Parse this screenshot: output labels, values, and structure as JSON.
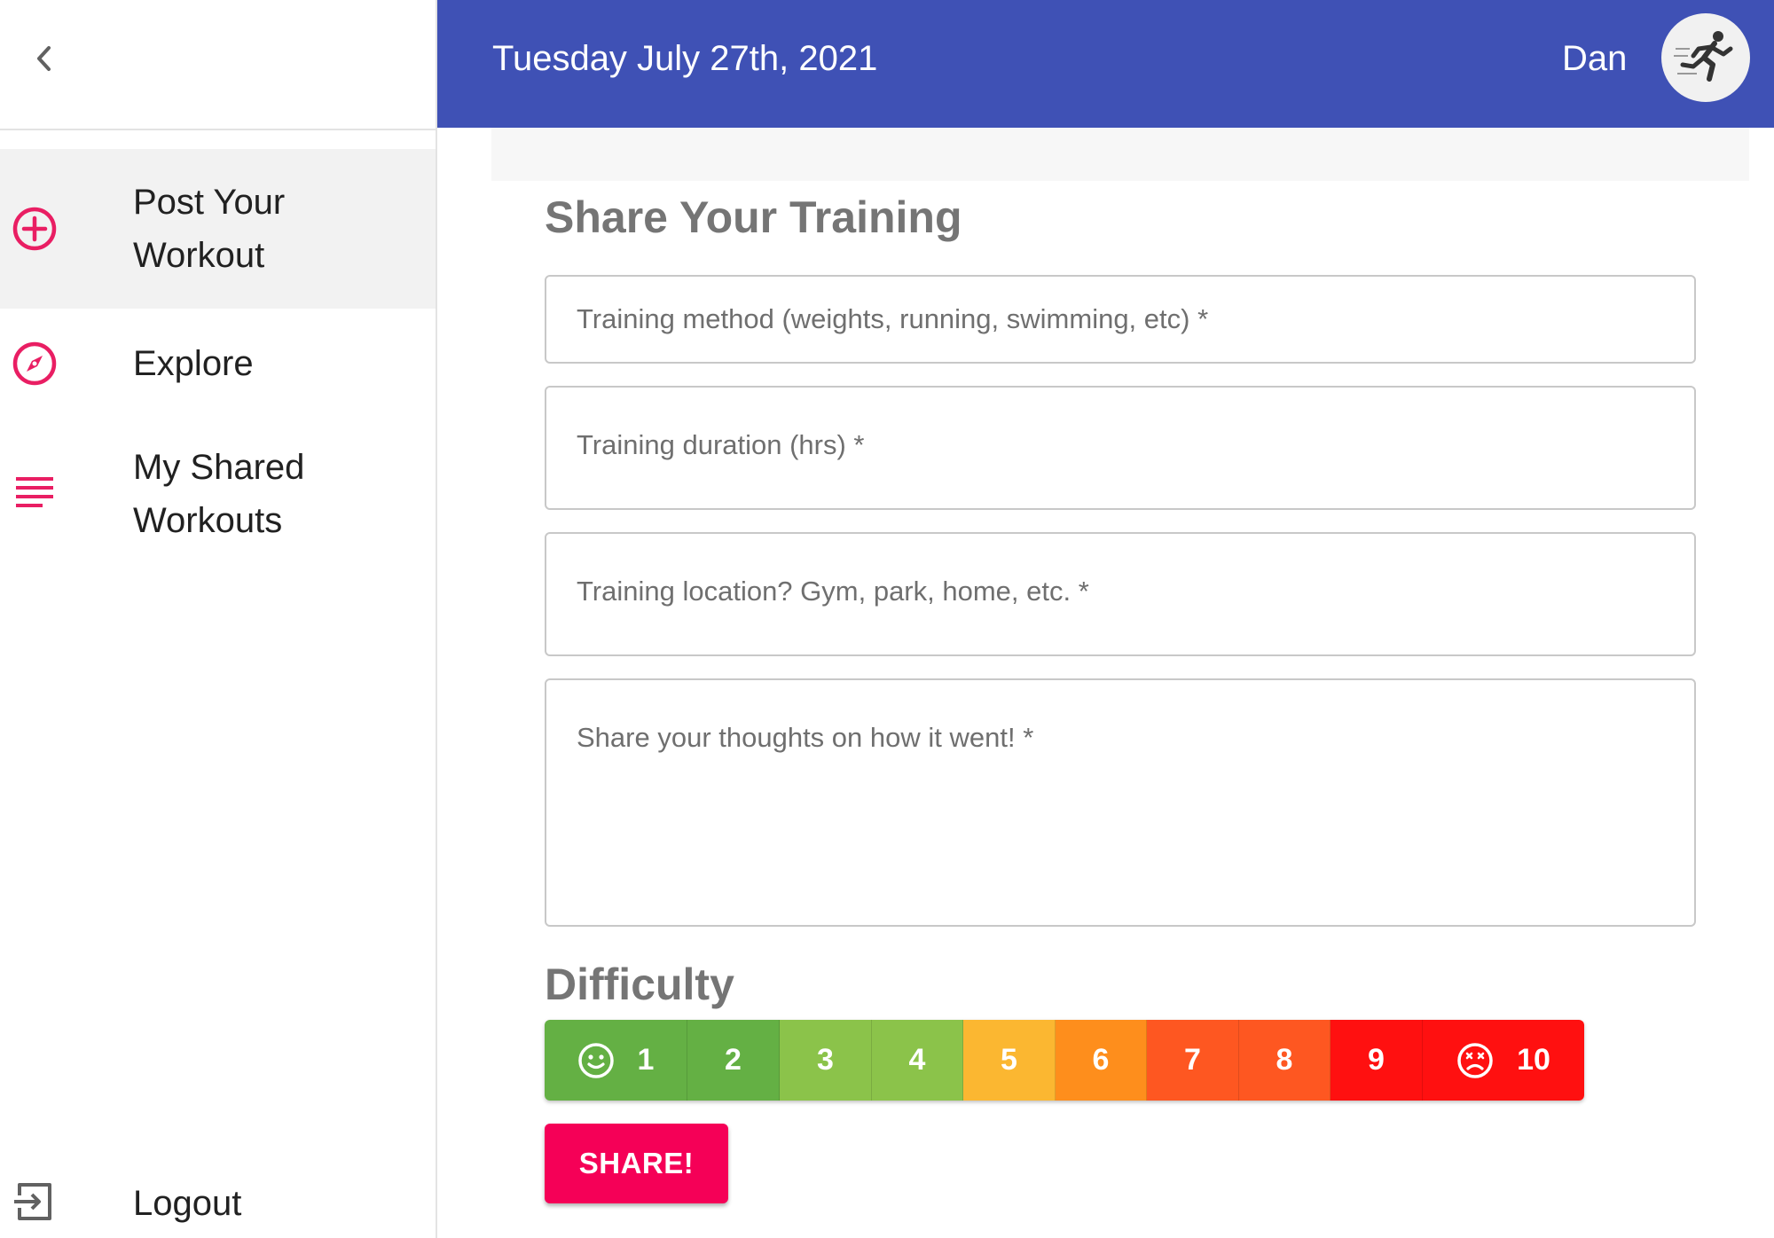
{
  "header": {
    "date": "Tuesday July 27th, 2021",
    "user_name": "Dan",
    "avatar_icon": "runner-avatar-icon",
    "bg_color": "#3f51b5"
  },
  "sidebar": {
    "back_icon": "chevron-left-icon",
    "items": [
      {
        "label": "Post Your Workout",
        "icon": "add-circle-icon",
        "active": true
      },
      {
        "label": "Explore",
        "icon": "compass-icon",
        "active": false
      },
      {
        "label": "My Shared Workouts",
        "icon": "list-lines-icon",
        "active": false
      }
    ],
    "logout": {
      "label": "Logout",
      "icon": "exit-icon"
    },
    "accent_color": "#e91e63"
  },
  "form": {
    "title": "Share Your Training",
    "fields": [
      {
        "placeholder": "Training method (weights, running, swimming, etc) *",
        "value": ""
      },
      {
        "placeholder": "Training duration (hrs) *",
        "value": ""
      },
      {
        "placeholder": "Training location? Gym, park, home, etc. *",
        "value": ""
      },
      {
        "placeholder": "Share your thoughts on how it went! *",
        "value": ""
      }
    ],
    "difficulty": {
      "title": "Difficulty",
      "levels": [
        {
          "label": "1",
          "color": "#64b044",
          "icon": "smiley-face-icon"
        },
        {
          "label": "2",
          "color": "#64b044"
        },
        {
          "label": "3",
          "color": "#8bc34a"
        },
        {
          "label": "4",
          "color": "#8bc34a"
        },
        {
          "label": "5",
          "color": "#fbb731"
        },
        {
          "label": "6",
          "color": "#fe8e1c"
        },
        {
          "label": "7",
          "color": "#fe5721"
        },
        {
          "label": "8",
          "color": "#fe5721"
        },
        {
          "label": "9",
          "color": "#ff1010"
        },
        {
          "label": "10",
          "color": "#ff1010",
          "icon": "sad-face-icon"
        }
      ]
    },
    "submit_label": "SHARE!",
    "submit_color": "#f50057"
  }
}
